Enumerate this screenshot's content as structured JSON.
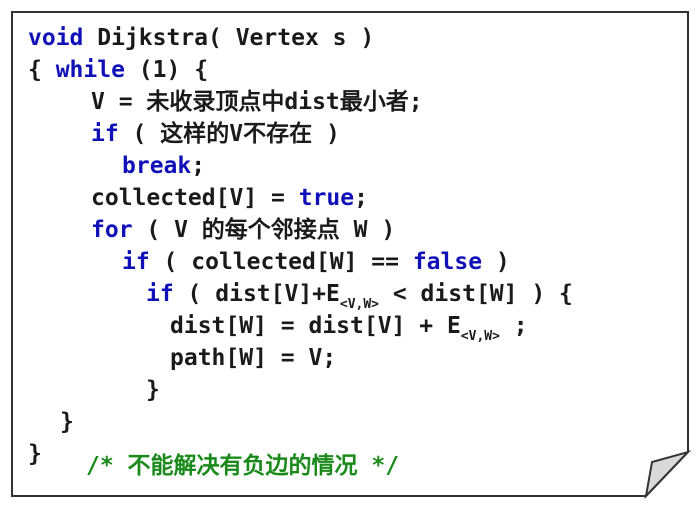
{
  "theme": {
    "keyword_color": "#1010b8",
    "text_color": "#1a1a1a",
    "comment_color": "#1a8a1a",
    "border_color": "#333333"
  },
  "code": {
    "line1": {
      "kw": "void",
      "text": " Dijkstra( Vertex s )"
    },
    "line2": {
      "pre": "{ ",
      "kw": "while",
      "post": " (1) {"
    },
    "line3": {
      "text": "V = 未收录顶点中dist最小者;"
    },
    "line4": {
      "kw": "if",
      "text": " ( 这样的V不存在 )"
    },
    "line5": {
      "kw": "break",
      "post": ";"
    },
    "line6": {
      "pre": "collected[V] = ",
      "kw": "true",
      "post": ";"
    },
    "line7": {
      "kw": "for",
      "text": " ( V 的每个邻接点 W )"
    },
    "line8": {
      "kw": "if",
      "pre": " ( collected[W] == ",
      "kw2": "false",
      "post": " )"
    },
    "line9": {
      "kw": "if",
      "pre": " ( dist[V]+E",
      "sub": "<V,W>",
      "post": " < dist[W] ) {"
    },
    "line10": {
      "pre": "dist[W] = dist[V] + E",
      "sub": "<V,W>",
      "post": " ;"
    },
    "line11": {
      "text": "path[W] = V;"
    },
    "line12": {
      "text": "}"
    },
    "line13": {
      "text": "}"
    },
    "line14": {
      "text": "}"
    },
    "comment": "/* 不能解决有负边的情况 */"
  }
}
